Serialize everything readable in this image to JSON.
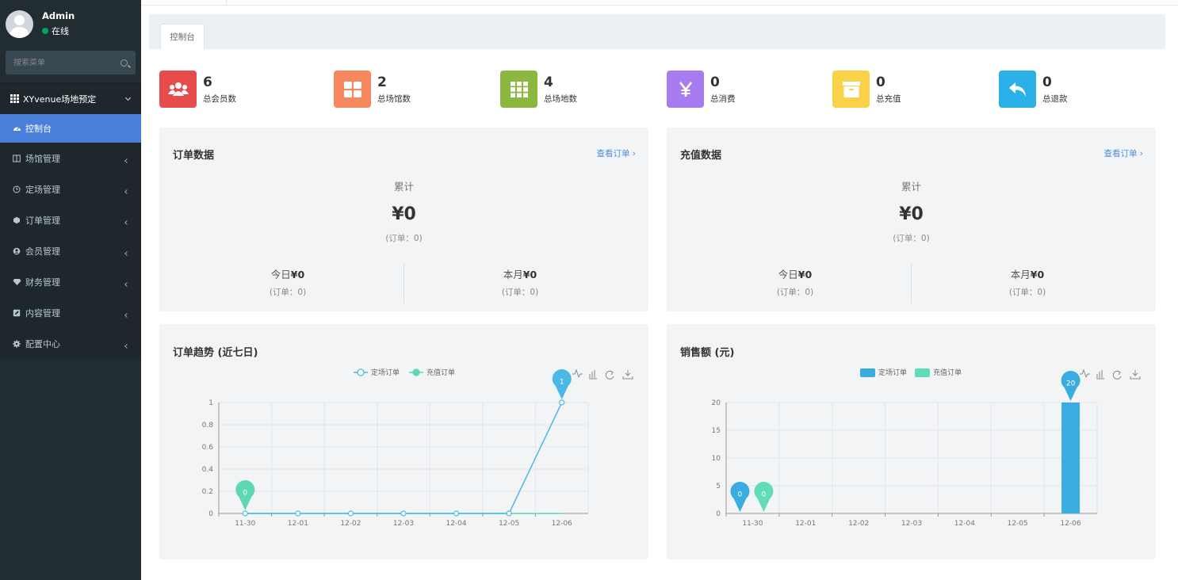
{
  "sidebar": {
    "user": {
      "name": "Admin",
      "status": "在线"
    },
    "search_placeholder": "搜索菜单",
    "group_title": "XYvenue场地预定",
    "items": [
      {
        "label": "控制台",
        "icon": "dashboard-icon",
        "active": true
      },
      {
        "label": "场馆管理",
        "icon": "columns-icon"
      },
      {
        "label": "定场管理",
        "icon": "clock-icon"
      },
      {
        "label": "订单管理",
        "icon": "cube-icon"
      },
      {
        "label": "会员管理",
        "icon": "user-circle-icon"
      },
      {
        "label": "财务管理",
        "icon": "diamond-icon"
      },
      {
        "label": "内容管理",
        "icon": "edit-icon"
      },
      {
        "label": "配置中心",
        "icon": "gear-icon"
      }
    ]
  },
  "tabs": [
    {
      "label": "控制台"
    }
  ],
  "stats": [
    {
      "value": "6",
      "label": "总会员数",
      "icon": "users-icon",
      "color": "#e64c4c"
    },
    {
      "value": "2",
      "label": "总场馆数",
      "icon": "th-large-icon",
      "color": "#f7875d"
    },
    {
      "value": "4",
      "label": "总场地数",
      "icon": "th-icon",
      "color": "#8ab83f"
    },
    {
      "value": "0",
      "label": "总消费",
      "icon": "yen-icon",
      "color": "#a87cf0"
    },
    {
      "value": "0",
      "label": "总充值",
      "icon": "archive-icon",
      "color": "#f9d24a"
    },
    {
      "value": "0",
      "label": "总退款",
      "icon": "reply-icon",
      "color": "#2bb1e8"
    }
  ],
  "order_panel": {
    "title": "订单数据",
    "link": "查看订单 ›",
    "total_label": "累计",
    "total_value": "¥0",
    "total_sub": "(订单：0)",
    "today_label": "今日",
    "today_value": "¥0",
    "today_sub": "(订单：0)",
    "month_label": "本月",
    "month_value": "¥0",
    "month_sub": "(订单：0)"
  },
  "recharge_panel": {
    "title": "充值数据",
    "link": "查看订单 ›",
    "total_label": "累计",
    "total_value": "¥0",
    "total_sub": "(订单：0)",
    "today_label": "今日",
    "today_value": "¥0",
    "today_sub": "(订单：0)",
    "month_label": "本月",
    "month_value": "¥0",
    "month_sub": "(订单：0)"
  },
  "chart_data": [
    {
      "type": "line",
      "title": "订单趋势 (近七日)",
      "categories": [
        "11-30",
        "12-01",
        "12-02",
        "12-03",
        "12-04",
        "12-05",
        "12-06"
      ],
      "series": [
        {
          "name": "定场订单",
          "values": [
            0,
            0,
            0,
            0,
            0,
            0,
            1
          ],
          "color": "#4bb8e8"
        },
        {
          "name": "充值订单",
          "values": [
            0,
            0,
            0,
            0,
            0,
            0,
            0
          ],
          "color": "#5ed8b4"
        }
      ],
      "ylim": [
        0,
        1
      ],
      "yticks": [
        "0",
        "0.2",
        "0.4",
        "0.6",
        "0.8",
        "1"
      ],
      "markers": [
        {
          "series": 0,
          "index": 6,
          "label": "1"
        },
        {
          "series": 1,
          "index": 0,
          "label": "0"
        }
      ],
      "legend": "top-center",
      "grid": true
    },
    {
      "type": "bar",
      "title": "销售额 (元)",
      "categories": [
        "11-30",
        "12-01",
        "12-02",
        "12-03",
        "12-04",
        "12-05",
        "12-06"
      ],
      "series": [
        {
          "name": "定场订单",
          "values": [
            0,
            0,
            0,
            0,
            0,
            0,
            20
          ],
          "color": "#3aace0"
        },
        {
          "name": "充值订单",
          "values": [
            0,
            0,
            0,
            0,
            0,
            0,
            0
          ],
          "color": "#62dcb8"
        }
      ],
      "ylim": [
        0,
        20
      ],
      "yticks": [
        "0",
        "5",
        "10",
        "15",
        "20"
      ],
      "markers": [
        {
          "series": 0,
          "index": 0,
          "label": "0"
        },
        {
          "series": 1,
          "index": 0,
          "label": "0"
        },
        {
          "series": 0,
          "index": 6,
          "label": "20"
        }
      ],
      "legend": "top-center",
      "grid": true
    }
  ]
}
